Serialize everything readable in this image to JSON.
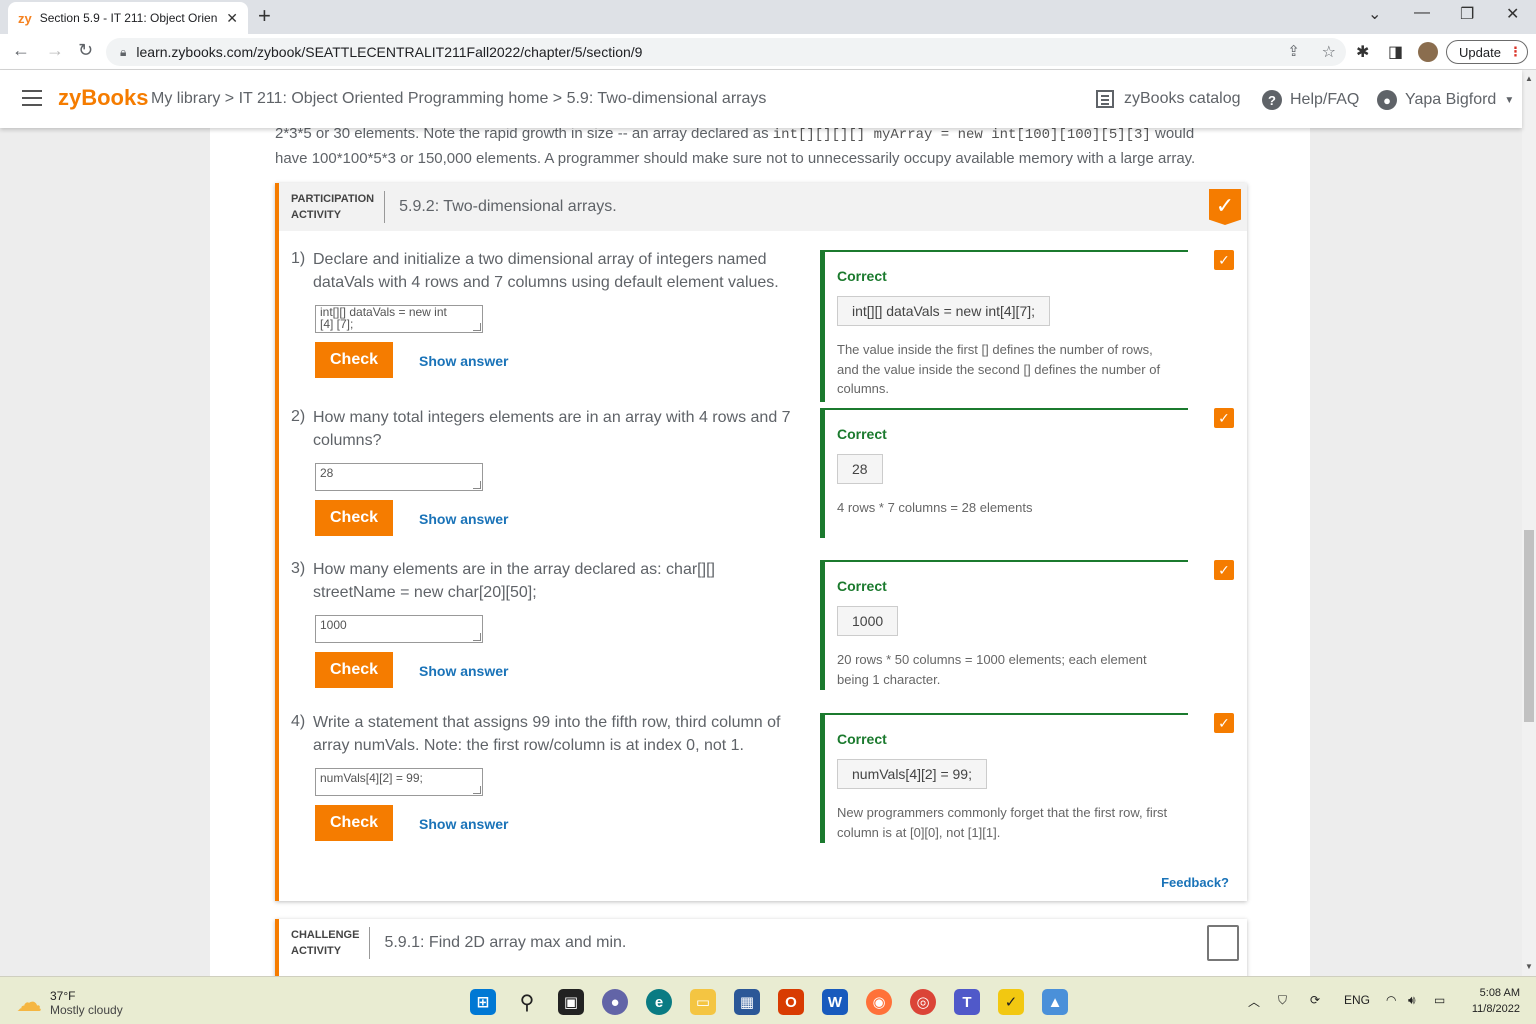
{
  "browser": {
    "tab_favicon": "zy",
    "tab_title": "Section 5.9 - IT 211: Object Orien",
    "url": "learn.zybooks.com/zybook/SEATTLECENTRALIT211Fall2022/chapter/5/section/9",
    "update_label": "Update"
  },
  "header": {
    "logo": "zyBooks",
    "breadcrumb": "My library > IT 211: Object Oriented Programming home > 5.9: Two-dimensional arrays",
    "catalog": "zyBooks catalog",
    "help": "Help/FAQ",
    "user": "Yapa Bigford"
  },
  "intro": {
    "line1_pre": "2*3*5 or 30 elements. Note the rapid growth in size -- an array declared as ",
    "line1_code": "int[][][][] myArray = new int[100][100][5][3]",
    "line1_post": " would",
    "line2": "have 100*100*5*3 or 150,000 elements. A programmer should make sure not to unnecessarily occupy available memory with a large array."
  },
  "participation": {
    "type_line1": "PARTICIPATION",
    "type_line2": "ACTIVITY",
    "title": "5.9.2: Two-dimensional arrays.",
    "check_label": "Check",
    "show_answer_label": "Show answer",
    "correct_label": "Correct",
    "feedback_link": "Feedback?",
    "questions": [
      {
        "num": "1)",
        "text": "Declare and initialize a two dimensional array of integers named dataVals with 4 rows and 7 columns using default element values.",
        "input": "int[][] dataVals = new int\n[4] [7];",
        "answer": "int[][] dataVals = new int[4][7];",
        "explanation": "The value inside the first [] defines the number of rows, and the value inside the second [] defines the number of columns."
      },
      {
        "num": "2)",
        "text": "How many total integers elements are in an array with 4 rows and 7 columns?",
        "input": "28",
        "answer": "28",
        "explanation": "4 rows * 7 columns = 28 elements"
      },
      {
        "num": "3)",
        "text": "How many elements are in the array declared as: char[][] streetName = new char[20][50];",
        "input": "1000",
        "answer": "1000",
        "explanation": "20 rows * 50 columns = 1000 elements; each element being 1 character."
      },
      {
        "num": "4)",
        "text": "Write a statement that assigns 99 into the fifth row, third column of array numVals. Note: the first row/column is at index 0, not 1.",
        "input": "numVals[4][2] = 99;",
        "answer": "numVals[4][2] = 99;",
        "explanation": "New programmers commonly forget that the first row, first column is at [0][0], not [1][1]."
      }
    ]
  },
  "challenge": {
    "type_line1": "CHALLENGE",
    "type_line2": "ACTIVITY",
    "title": "5.9.1: Find 2D array max and min."
  },
  "taskbar": {
    "temp": "37°F",
    "weather": "Mostly cloudy",
    "lang": "ENG",
    "time": "5:08 AM",
    "date": "11/8/2022"
  }
}
